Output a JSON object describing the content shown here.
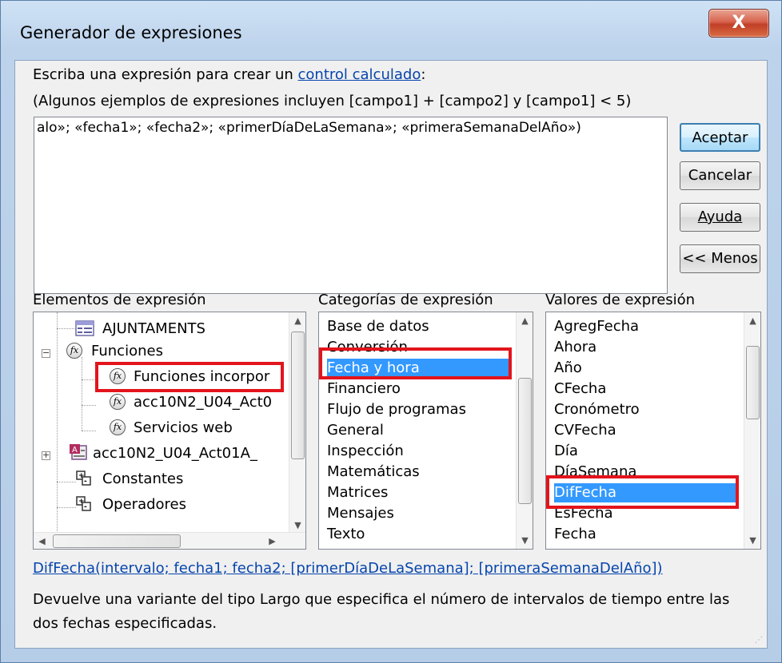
{
  "window": {
    "title": "Generador de expresiones",
    "close_label": "X"
  },
  "instructions": {
    "line1_prefix": "Escriba una expresión para crear un ",
    "line1_link": "control calculado",
    "line1_suffix": ":",
    "line2": "(Algunos ejemplos de expresiones incluyen [campo1] + [campo2] y [campo1] < 5)"
  },
  "expression_box": {
    "value": "alo»; «fecha1»; «fecha2»; «primerDíaDeLaSemana»; «primeraSemanaDelAño»)"
  },
  "buttons": {
    "aceptar": "Aceptar",
    "cancelar": "Cancelar",
    "ayuda": "Ayuda",
    "menos": "<< Menos"
  },
  "panels": {
    "elementos_label": "Elementos de expresión",
    "categorias_label": "Categorías de expresión",
    "valores_label": "Valores de expresión"
  },
  "elementos_tree": [
    "AJUNTAMENTS",
    "Funciones",
    "Funciones incorpor",
    "acc10N2_U04_Act0",
    "Servicios web",
    "acc10N2_U04_Act01A_",
    "Constantes",
    "Operadores"
  ],
  "categorias": [
    "Base de datos",
    "Conversión",
    "Fecha y hora",
    "Financiero",
    "Flujo de programas",
    "General",
    "Inspección",
    "Matemáticas",
    "Matrices",
    "Mensajes",
    "Texto"
  ],
  "valores": [
    "AgregFecha",
    "Ahora",
    "Año",
    "CFecha",
    "Cronómetro",
    "CVFecha",
    "Día",
    "DíaSemana",
    "DifFecha",
    "EsFecha",
    "Fecha"
  ],
  "selected": {
    "elemento": "Funciones incorpor",
    "categoria": "Fecha y hora",
    "valor": "DifFecha"
  },
  "footer": {
    "syntax_link": "DifFecha(intervalo; fecha1; fecha2; [primerDíaDeLaSemana]; [primeraSemanaDelAño])",
    "description": "Devuelve una variante del tipo Largo que especifica el número de intervalos de tiempo entre las dos fechas especificadas."
  },
  "icons": {
    "table": "table-icon",
    "function": "fx-icon",
    "form": "form-icon",
    "constants": "constants-icon",
    "operators": "operators-icon"
  },
  "colors": {
    "selection": "#3399ff",
    "highlight_box": "#e3141c",
    "link": "#0645ad"
  }
}
